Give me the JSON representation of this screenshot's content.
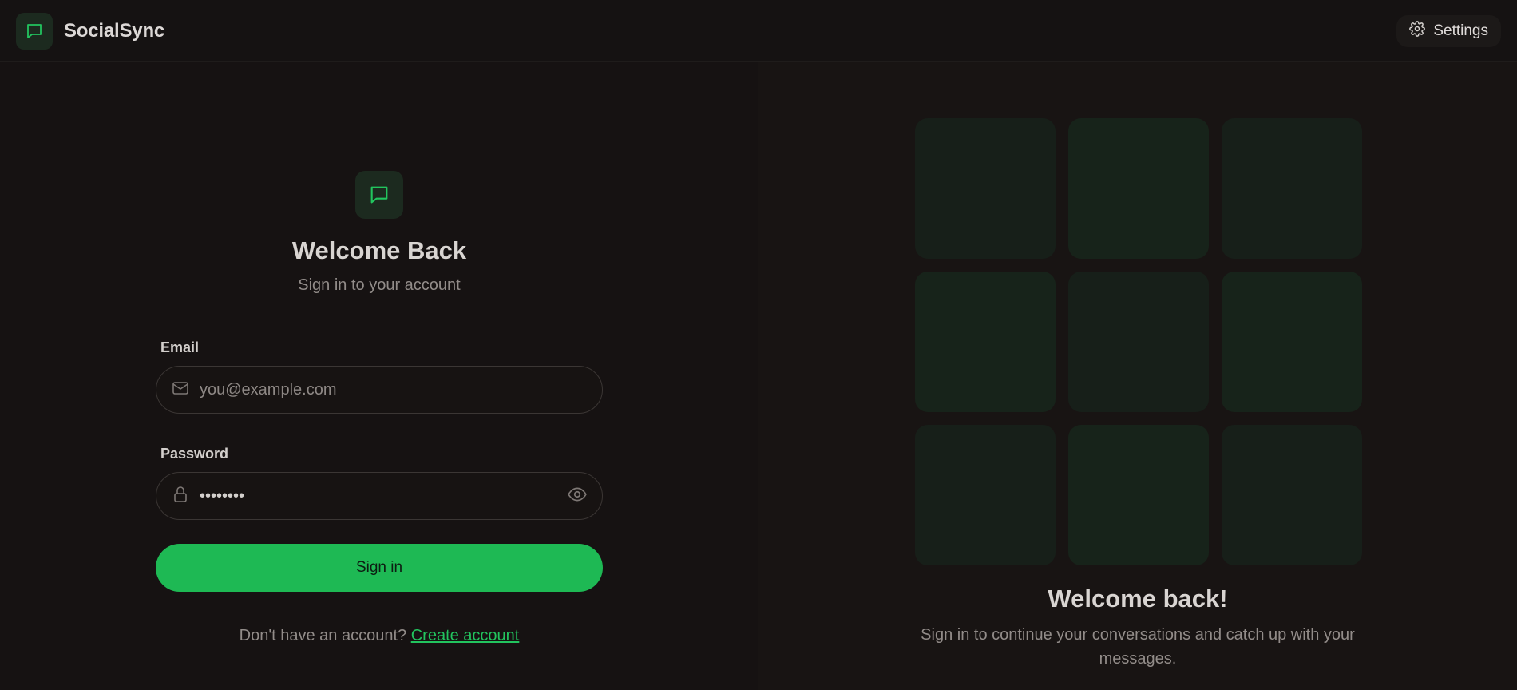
{
  "app": {
    "name": "SocialSync"
  },
  "header": {
    "settings_label": "Settings"
  },
  "login": {
    "title": "Welcome Back",
    "subtitle": "Sign in to your account",
    "email_label": "Email",
    "email_placeholder": "you@example.com",
    "password_label": "Password",
    "password_value": "password",
    "signin_label": "Sign in",
    "signup_prompt": "Don't have an account?",
    "signup_link": "Create account"
  },
  "hero": {
    "title": "Welcome back!",
    "text": "Sign in to continue your conversations and catch up with your messages.",
    "tiles": [
      "#171f19",
      "#17231a",
      "#171f19",
      "#17231a",
      "#171f19",
      "#17231a",
      "#171f19",
      "#17231a",
      "#171f19"
    ]
  },
  "colors": {
    "accent": "#1eb954",
    "background": "#151212"
  },
  "icons": {
    "brand": "message-square-icon",
    "settings": "gear-icon",
    "email": "mail-icon",
    "password": "lock-icon",
    "toggle": "eye-icon"
  }
}
